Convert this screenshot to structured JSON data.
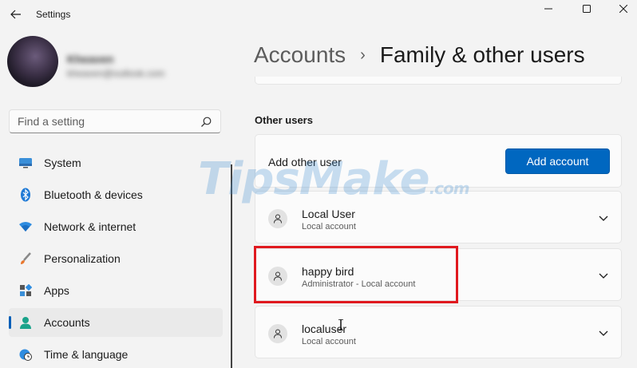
{
  "window": {
    "title": "Settings",
    "back_icon": "back-arrow-icon",
    "controls": [
      "minimize-icon",
      "maximize-icon",
      "close-icon"
    ]
  },
  "profile": {
    "name": "Kheaven",
    "email": "kheaven@outlook.com"
  },
  "search": {
    "placeholder": "Find a setting",
    "icon": "search-icon"
  },
  "nav": {
    "items": [
      {
        "label": "System",
        "icon": "monitor-icon"
      },
      {
        "label": "Bluetooth & devices",
        "icon": "bluetooth-icon"
      },
      {
        "label": "Network & internet",
        "icon": "wifi-icon"
      },
      {
        "label": "Personalization",
        "icon": "brush-icon"
      },
      {
        "label": "Apps",
        "icon": "apps-icon"
      },
      {
        "label": "Accounts",
        "icon": "person-icon",
        "active": true
      },
      {
        "label": "Time & language",
        "icon": "globe-clock-icon"
      }
    ]
  },
  "header": {
    "parent": "Accounts",
    "separator": "›",
    "current": "Family & other users"
  },
  "other_users": {
    "section_title": "Other users",
    "add_label": "Add other user",
    "add_button": "Add account",
    "users": [
      {
        "name": "Local User",
        "type": "Local account"
      },
      {
        "name": "happy bird",
        "type": "Administrator - Local account"
      },
      {
        "name": "localuser",
        "type": "Local account"
      }
    ]
  },
  "watermark": {
    "brand": "TipsMake",
    "suffix": ".com"
  },
  "colors": {
    "accent": "#0067c0",
    "highlight": "#e0191f",
    "background": "#f3f3f3"
  }
}
